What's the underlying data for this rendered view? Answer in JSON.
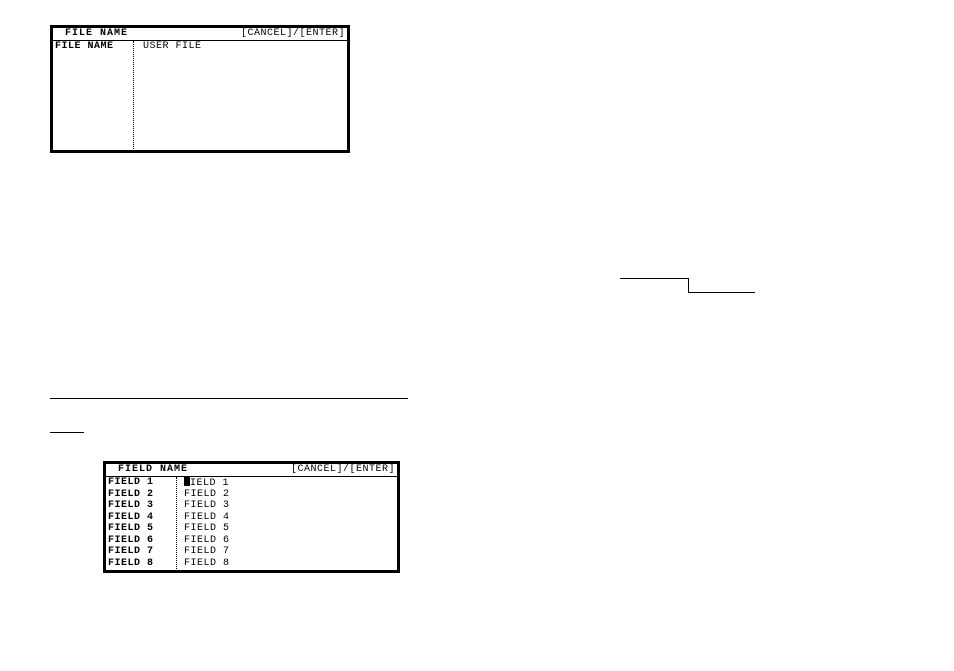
{
  "panel1": {
    "title": "FILE NAME",
    "hint": "[CANCEL]/[ENTER]",
    "row": {
      "label": "FILE NAME",
      "value": "USER FILE"
    }
  },
  "panel2": {
    "title": "FIELD NAME",
    "hint": "[CANCEL]/[ENTER]",
    "rows": [
      {
        "label": "FIELD 1",
        "value_prefix": "",
        "cursor": true,
        "value_suffix": "IELD 1"
      },
      {
        "label": "FIELD 2",
        "value_prefix": "FIELD 2",
        "cursor": false,
        "value_suffix": ""
      },
      {
        "label": "FIELD 3",
        "value_prefix": "FIELD 3",
        "cursor": false,
        "value_suffix": ""
      },
      {
        "label": "FIELD 4",
        "value_prefix": "FIELD 4",
        "cursor": false,
        "value_suffix": ""
      },
      {
        "label": "FIELD 5",
        "value_prefix": "FIELD 5",
        "cursor": false,
        "value_suffix": ""
      },
      {
        "label": "FIELD 6",
        "value_prefix": "FIELD 6",
        "cursor": false,
        "value_suffix": ""
      },
      {
        "label": "FIELD 7",
        "value_prefix": "FIELD 7",
        "cursor": false,
        "value_suffix": ""
      },
      {
        "label": "FIELD 8",
        "value_prefix": "FIELD 8",
        "cursor": false,
        "value_suffix": ""
      }
    ]
  }
}
